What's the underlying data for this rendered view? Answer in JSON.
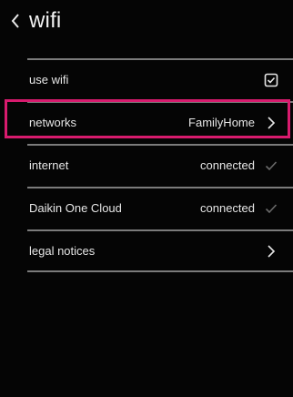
{
  "header": {
    "title": "wifi",
    "back_icon": "chevron-left-icon"
  },
  "rows": [
    {
      "label": "use wifi",
      "value": "",
      "trailing_icon": "checkbox-checked-icon"
    },
    {
      "label": "networks",
      "value": "FamilyHome",
      "trailing_icon": "chevron-right-icon"
    },
    {
      "label": "internet",
      "value": "connected",
      "trailing_icon": "check-icon"
    },
    {
      "label": "Daikin One Cloud",
      "value": "connected",
      "trailing_icon": "check-icon"
    },
    {
      "label": "legal notices",
      "value": "",
      "trailing_icon": "chevron-right-icon"
    }
  ],
  "colors": {
    "background": "#050505",
    "text": "#e6e6e6",
    "divider": "#7b7b7b",
    "highlight": "#d81b6e"
  }
}
